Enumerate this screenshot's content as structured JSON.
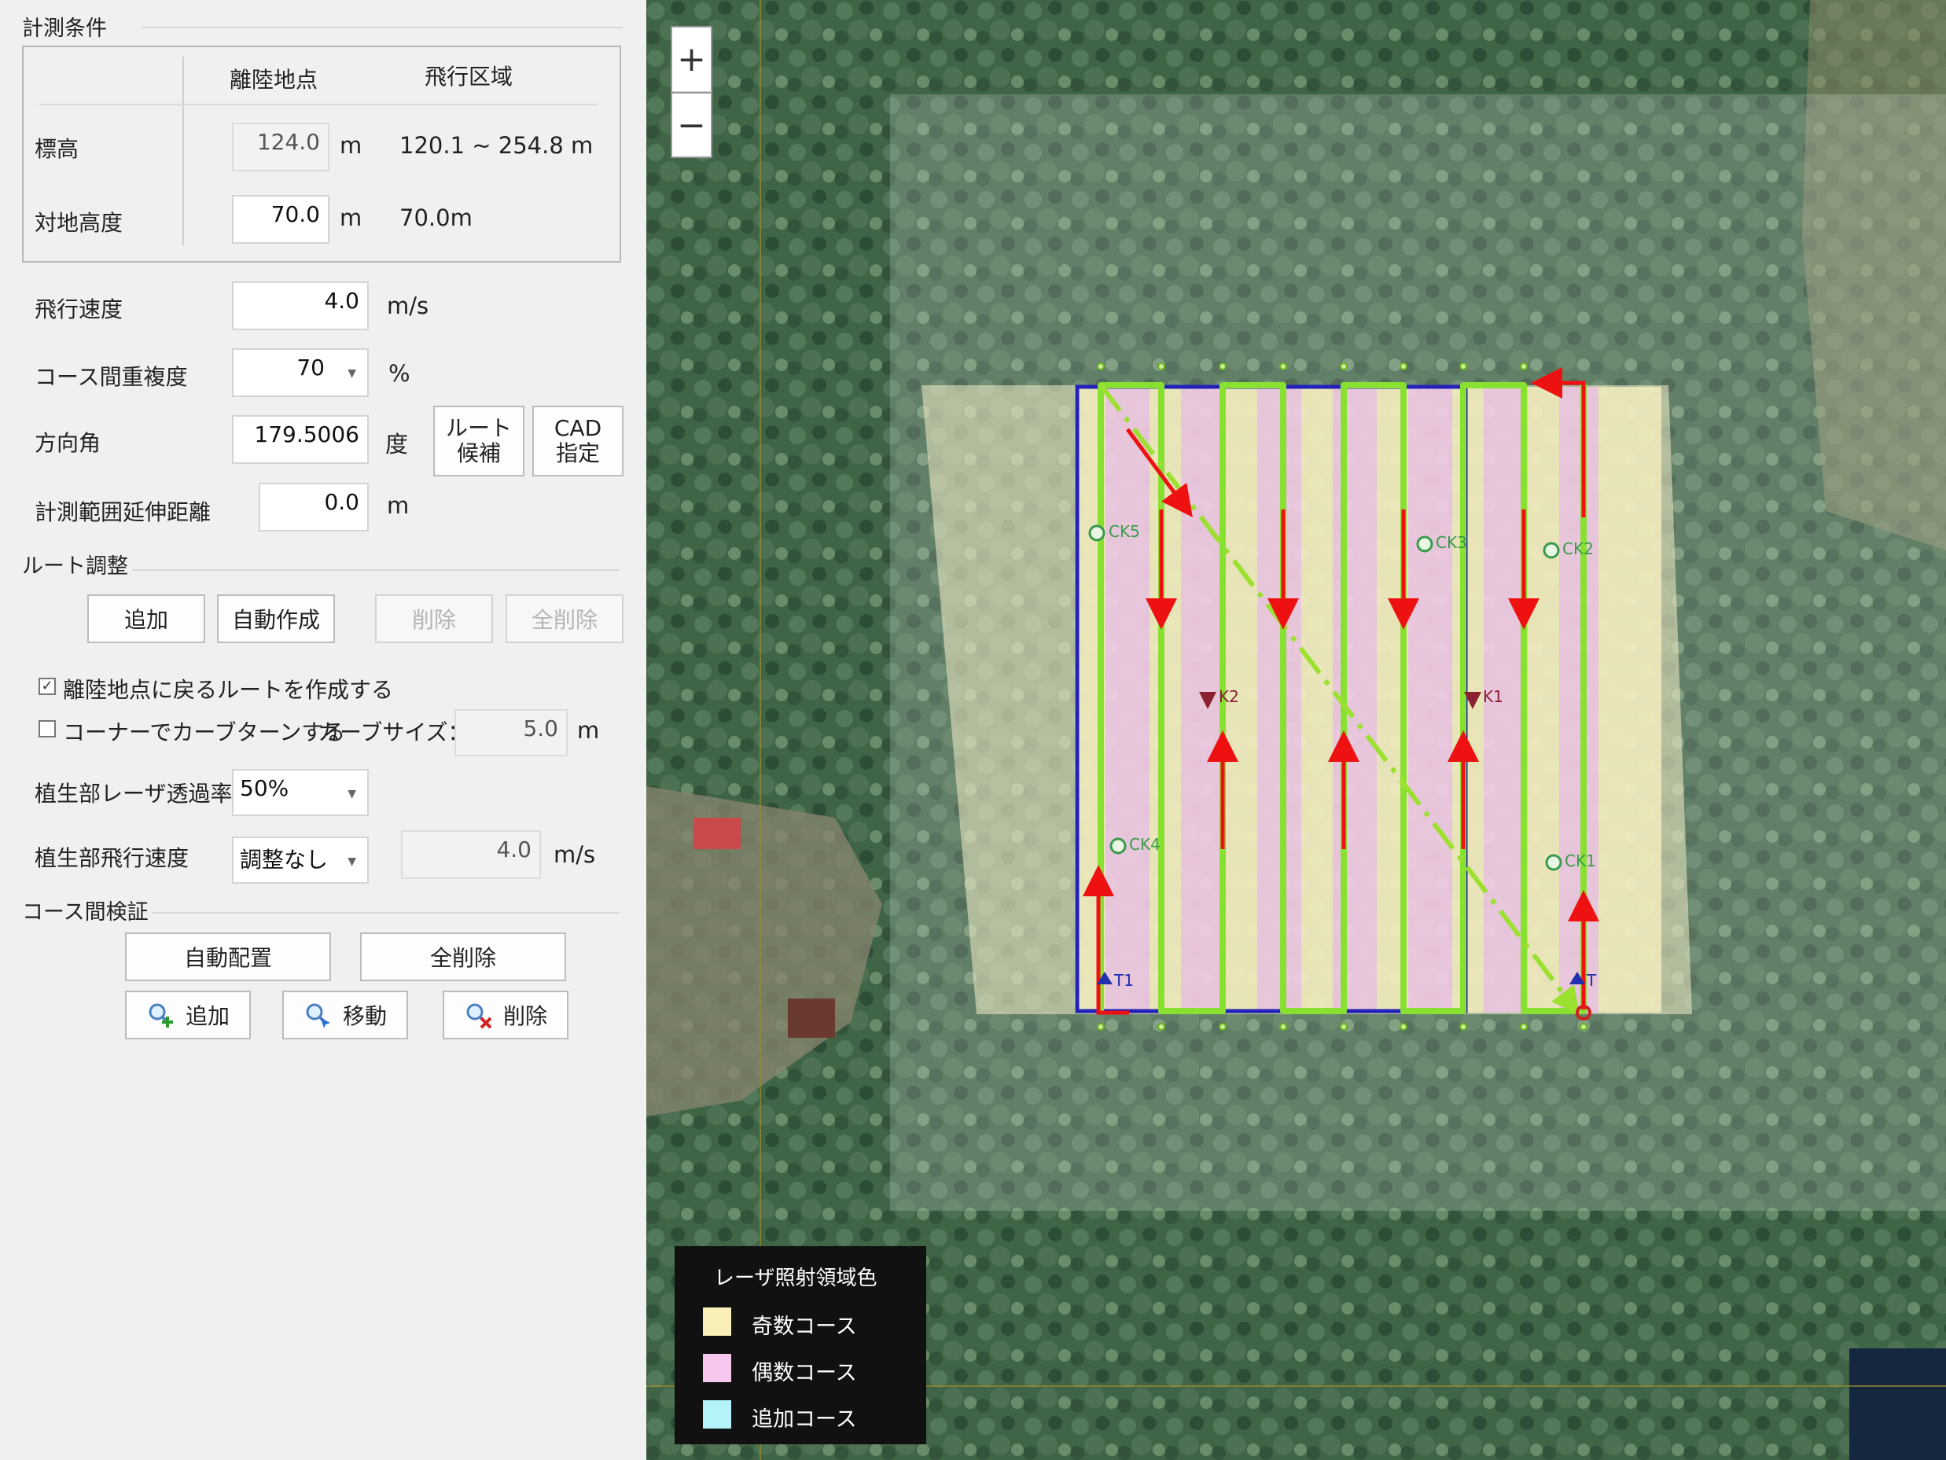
{
  "measurement": {
    "section_title": "計測条件",
    "col_takeoff": "離陸地点",
    "col_area": "飛行区域",
    "altitude_label": "標高",
    "altitude_value": "124.0",
    "altitude_unit": "m",
    "altitude_range": "120.1 ~ 254.8 m",
    "ground_height_label": "対地高度",
    "ground_height_value": "70.0",
    "ground_height_unit": "m",
    "ground_height_area": "70.0m",
    "speed_label": "飛行速度",
    "speed_value": "4.0",
    "speed_unit": "m/s",
    "overlap_label": "コース間重複度",
    "overlap_value": "70",
    "overlap_unit": "%",
    "heading_label": "方向角",
    "heading_value": "179.5006",
    "heading_unit": "度",
    "route_candidate_line1": "ルート",
    "route_candidate_line2": "候補",
    "cad_line1": "CAD",
    "cad_line2": "指定",
    "extension_label": "計測範囲延伸距離",
    "extension_value": "0.0",
    "extension_unit": "m"
  },
  "route": {
    "section_title": "ルート調整",
    "add": "追加",
    "auto_create": "自動作成",
    "delete": "削除",
    "delete_all": "全削除",
    "return_route_label": "離陸地点に戻るルートを作成する",
    "return_route_checked": true,
    "corner_curve_label": "コーナーでカーブターンする",
    "curve_size_label": "カーブサイズ：",
    "curve_size_value": "5.0",
    "curve_size_unit": "m",
    "laser_rate_label": "植生部レーザ透過率",
    "laser_rate_value": "50%",
    "veg_speed_label": "植生部飛行速度",
    "veg_speed_select": "調整なし",
    "veg_speed_value": "4.0",
    "veg_speed_unit": "m/s"
  },
  "verify": {
    "section_title": "コース間検証",
    "auto_place": "自動配置",
    "delete_all": "全削除",
    "add": "追加",
    "move": "移動",
    "delete": "削除"
  },
  "map": {
    "zoom_in": "+",
    "zoom_out": "−",
    "markers": [
      "CK5",
      "CK3",
      "CK2",
      "K2",
      "K1",
      "CK4",
      "CK1",
      "T1",
      "T"
    ],
    "legend": {
      "title": "レーザ照射領域色",
      "items": [
        {
          "label": "奇数コース",
          "color": "#f8f0b8"
        },
        {
          "label": "偶数コース",
          "color": "#f6c6ec"
        },
        {
          "label": "追加コース",
          "color": "#b4f4f8"
        }
      ]
    }
  },
  "colors": {
    "route_line": "#88e030",
    "arrow": "#ee1111",
    "boundary": "#2222bb"
  }
}
